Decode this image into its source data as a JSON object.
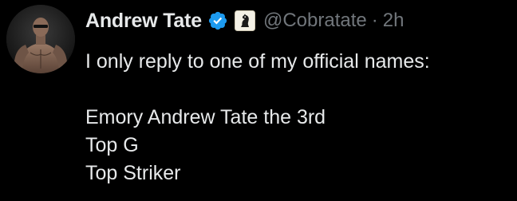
{
  "tweet": {
    "author": {
      "display_name": "Andrew Tate",
      "handle": "@Cobratate",
      "verified_icon": "verified-badge-icon",
      "affiliate_icon": "chess-knight-badge-icon",
      "avatar_icon": "profile-photo"
    },
    "separator": "·",
    "timestamp": "2h",
    "lines": [
      "I only reply to one of my official names:",
      "",
      "Emory Andrew Tate the 3rd",
      "Top G",
      "Top Striker"
    ]
  },
  "colors": {
    "background": "#000000",
    "primary_text": "#e7e9ea",
    "secondary_text": "#71767b",
    "verified_blue": "#1d9bf0"
  }
}
